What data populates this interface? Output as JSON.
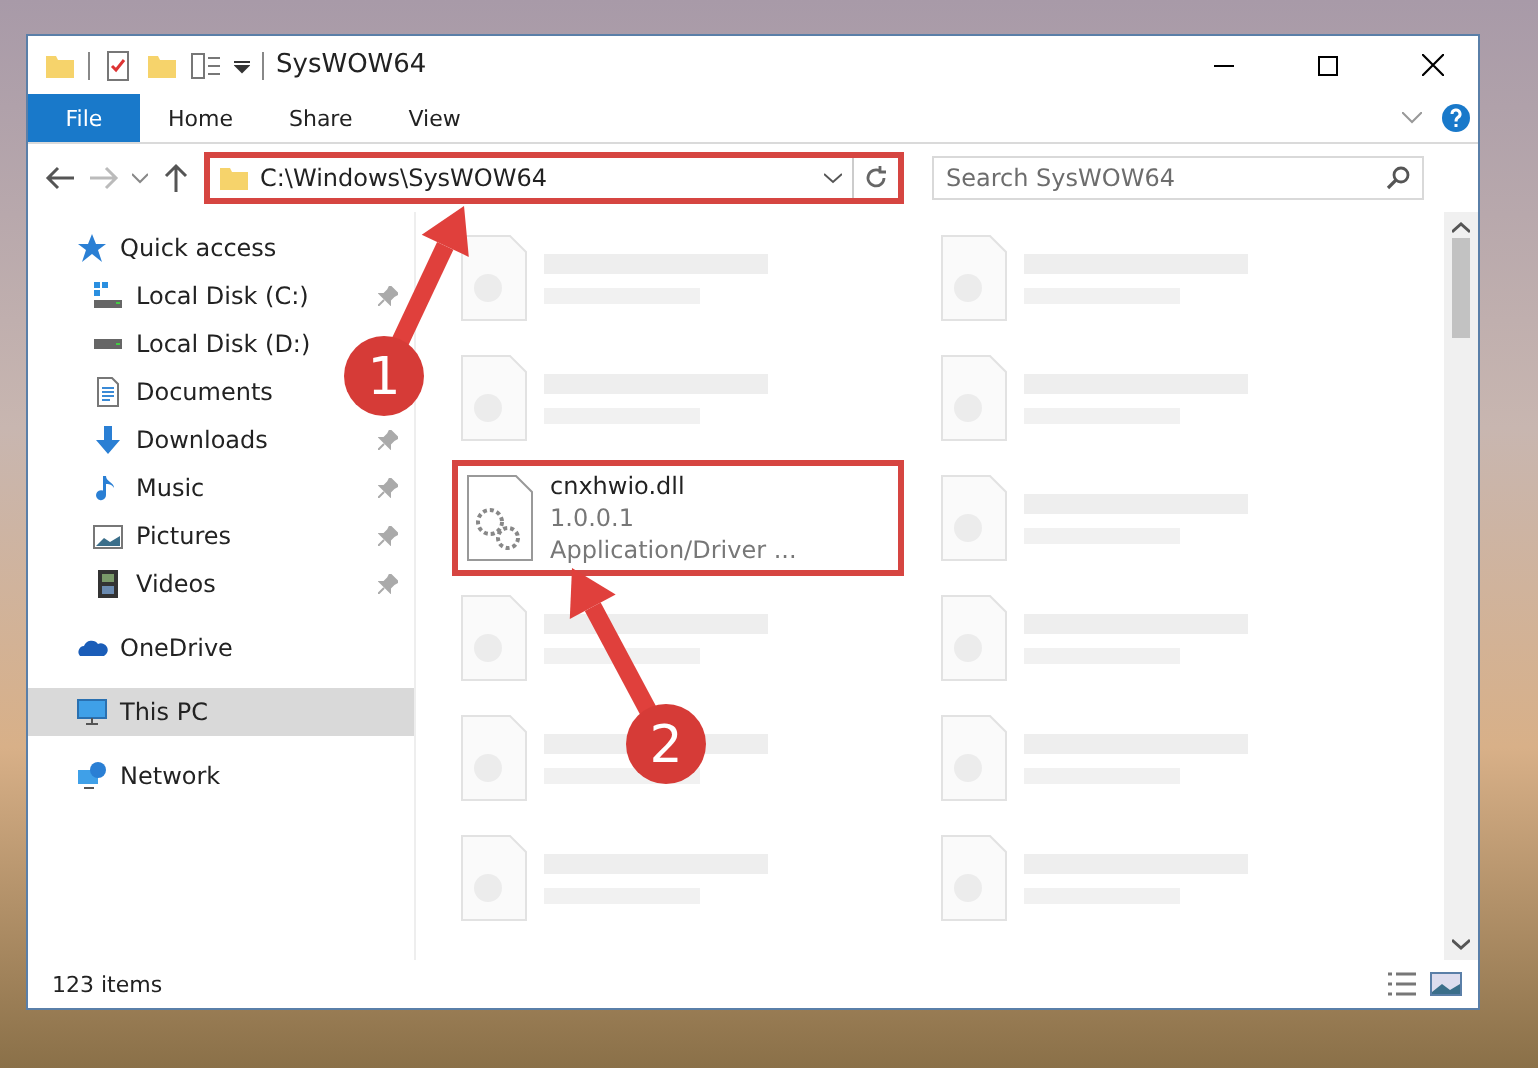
{
  "window": {
    "title": "SysWOW64"
  },
  "ribbon_tabs": [
    {
      "label": "File",
      "selected": true
    },
    {
      "label": "Home",
      "selected": false
    },
    {
      "label": "Share",
      "selected": false
    },
    {
      "label": "View",
      "selected": false
    }
  ],
  "address_bar": {
    "value": "C:\\Windows\\SysWOW64",
    "marked": true
  },
  "search": {
    "placeholder": "Search SysWOW64"
  },
  "sidebar": {
    "items": [
      {
        "label": "Quick access",
        "kind": "quick",
        "pinned": false,
        "selected": false,
        "children": [
          {
            "label": "Local Disk (C:)",
            "kind": "diskc",
            "pinned": true,
            "selected": false
          },
          {
            "label": "Local Disk (D:)",
            "kind": "disk",
            "pinned": false,
            "selected": false
          },
          {
            "label": "Documents",
            "kind": "documents",
            "selected": false
          },
          {
            "label": "Downloads",
            "kind": "downloads",
            "pinned": true,
            "selected": false
          },
          {
            "label": "Music",
            "kind": "music",
            "pinned": true,
            "selected": false
          },
          {
            "label": "Pictures",
            "kind": "pictures",
            "pinned": true,
            "selected": false
          },
          {
            "label": "Videos",
            "kind": "videos",
            "pinned": true,
            "selected": false
          }
        ]
      },
      {
        "label": "OneDrive",
        "kind": "cloud",
        "pinned": false,
        "selected": false
      },
      {
        "label": "This PC",
        "kind": "pc",
        "pinned": false,
        "selected": true
      },
      {
        "label": "Network",
        "kind": "network",
        "pinned": false,
        "selected": false
      }
    ]
  },
  "files": [
    {
      "kind": "blurred",
      "marked": false
    },
    {
      "kind": "blurred",
      "marked": false
    },
    {
      "kind": "blurred",
      "marked": false
    },
    {
      "kind": "blurred",
      "marked": false
    },
    {
      "kind": "file",
      "name": "cnxhwio.dll",
      "version": "1.0.0.1",
      "type": "Application/Driver ...",
      "marked": true
    },
    {
      "kind": "blurred",
      "marked": false
    },
    {
      "kind": "blurred",
      "marked": false
    },
    {
      "kind": "blurred",
      "marked": false
    },
    {
      "kind": "blurred",
      "marked": false
    },
    {
      "kind": "blurred",
      "marked": false
    },
    {
      "kind": "blurred",
      "marked": false
    },
    {
      "kind": "blurred",
      "marked": false
    }
  ],
  "status_bar": {
    "count": "123 items"
  },
  "callouts": [
    {
      "number": "1"
    },
    {
      "number": "2"
    }
  ]
}
